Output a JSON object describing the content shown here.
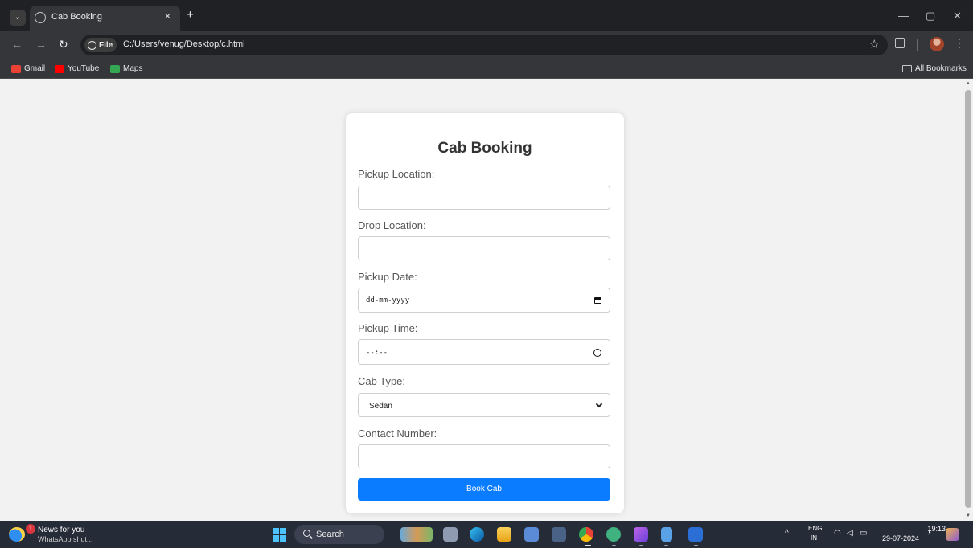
{
  "browser": {
    "tab_title": "Cab Booking",
    "tab_close": "×",
    "new_tab": "+",
    "file_label": "File",
    "url": "C:/Users/venug/Desktop/c.html",
    "bookmarks": [
      {
        "label": "Gmail",
        "color": "#ea4335"
      },
      {
        "label": "YouTube",
        "color": "#ff0000"
      },
      {
        "label": "Maps",
        "color": "#34a853"
      }
    ],
    "all_bookmarks": "All Bookmarks"
  },
  "form": {
    "title": "Cab Booking",
    "pickup_location_label": "Pickup Location:",
    "pickup_location_value": "",
    "drop_location_label": "Drop Location:",
    "drop_location_value": "",
    "pickup_date_label": "Pickup Date:",
    "pickup_date_placeholder": "dd-mm-yyyy",
    "pickup_time_label": "Pickup Time:",
    "pickup_time_placeholder": "--:--",
    "cab_type_label": "Cab Type:",
    "cab_type_value": "Sedan",
    "contact_number_label": "Contact Number:",
    "contact_number_value": "",
    "submit_label": "Book Cab",
    "accent_color": "#0a7cff"
  },
  "taskbar": {
    "news_badge": "1",
    "news_title": "News for you",
    "news_subtitle": "WhatsApp shut...",
    "search_label": "Search",
    "apps": [
      "widgets-game",
      "file-explorer-card",
      "edge",
      "file-explorer",
      "teams",
      "calculator",
      "chrome",
      "chrome-alt",
      "visual-studio",
      "notepad",
      "word"
    ],
    "lang_line1": "ENG",
    "lang_line2": "IN",
    "time": "19:13",
    "date": "29-07-2024"
  }
}
